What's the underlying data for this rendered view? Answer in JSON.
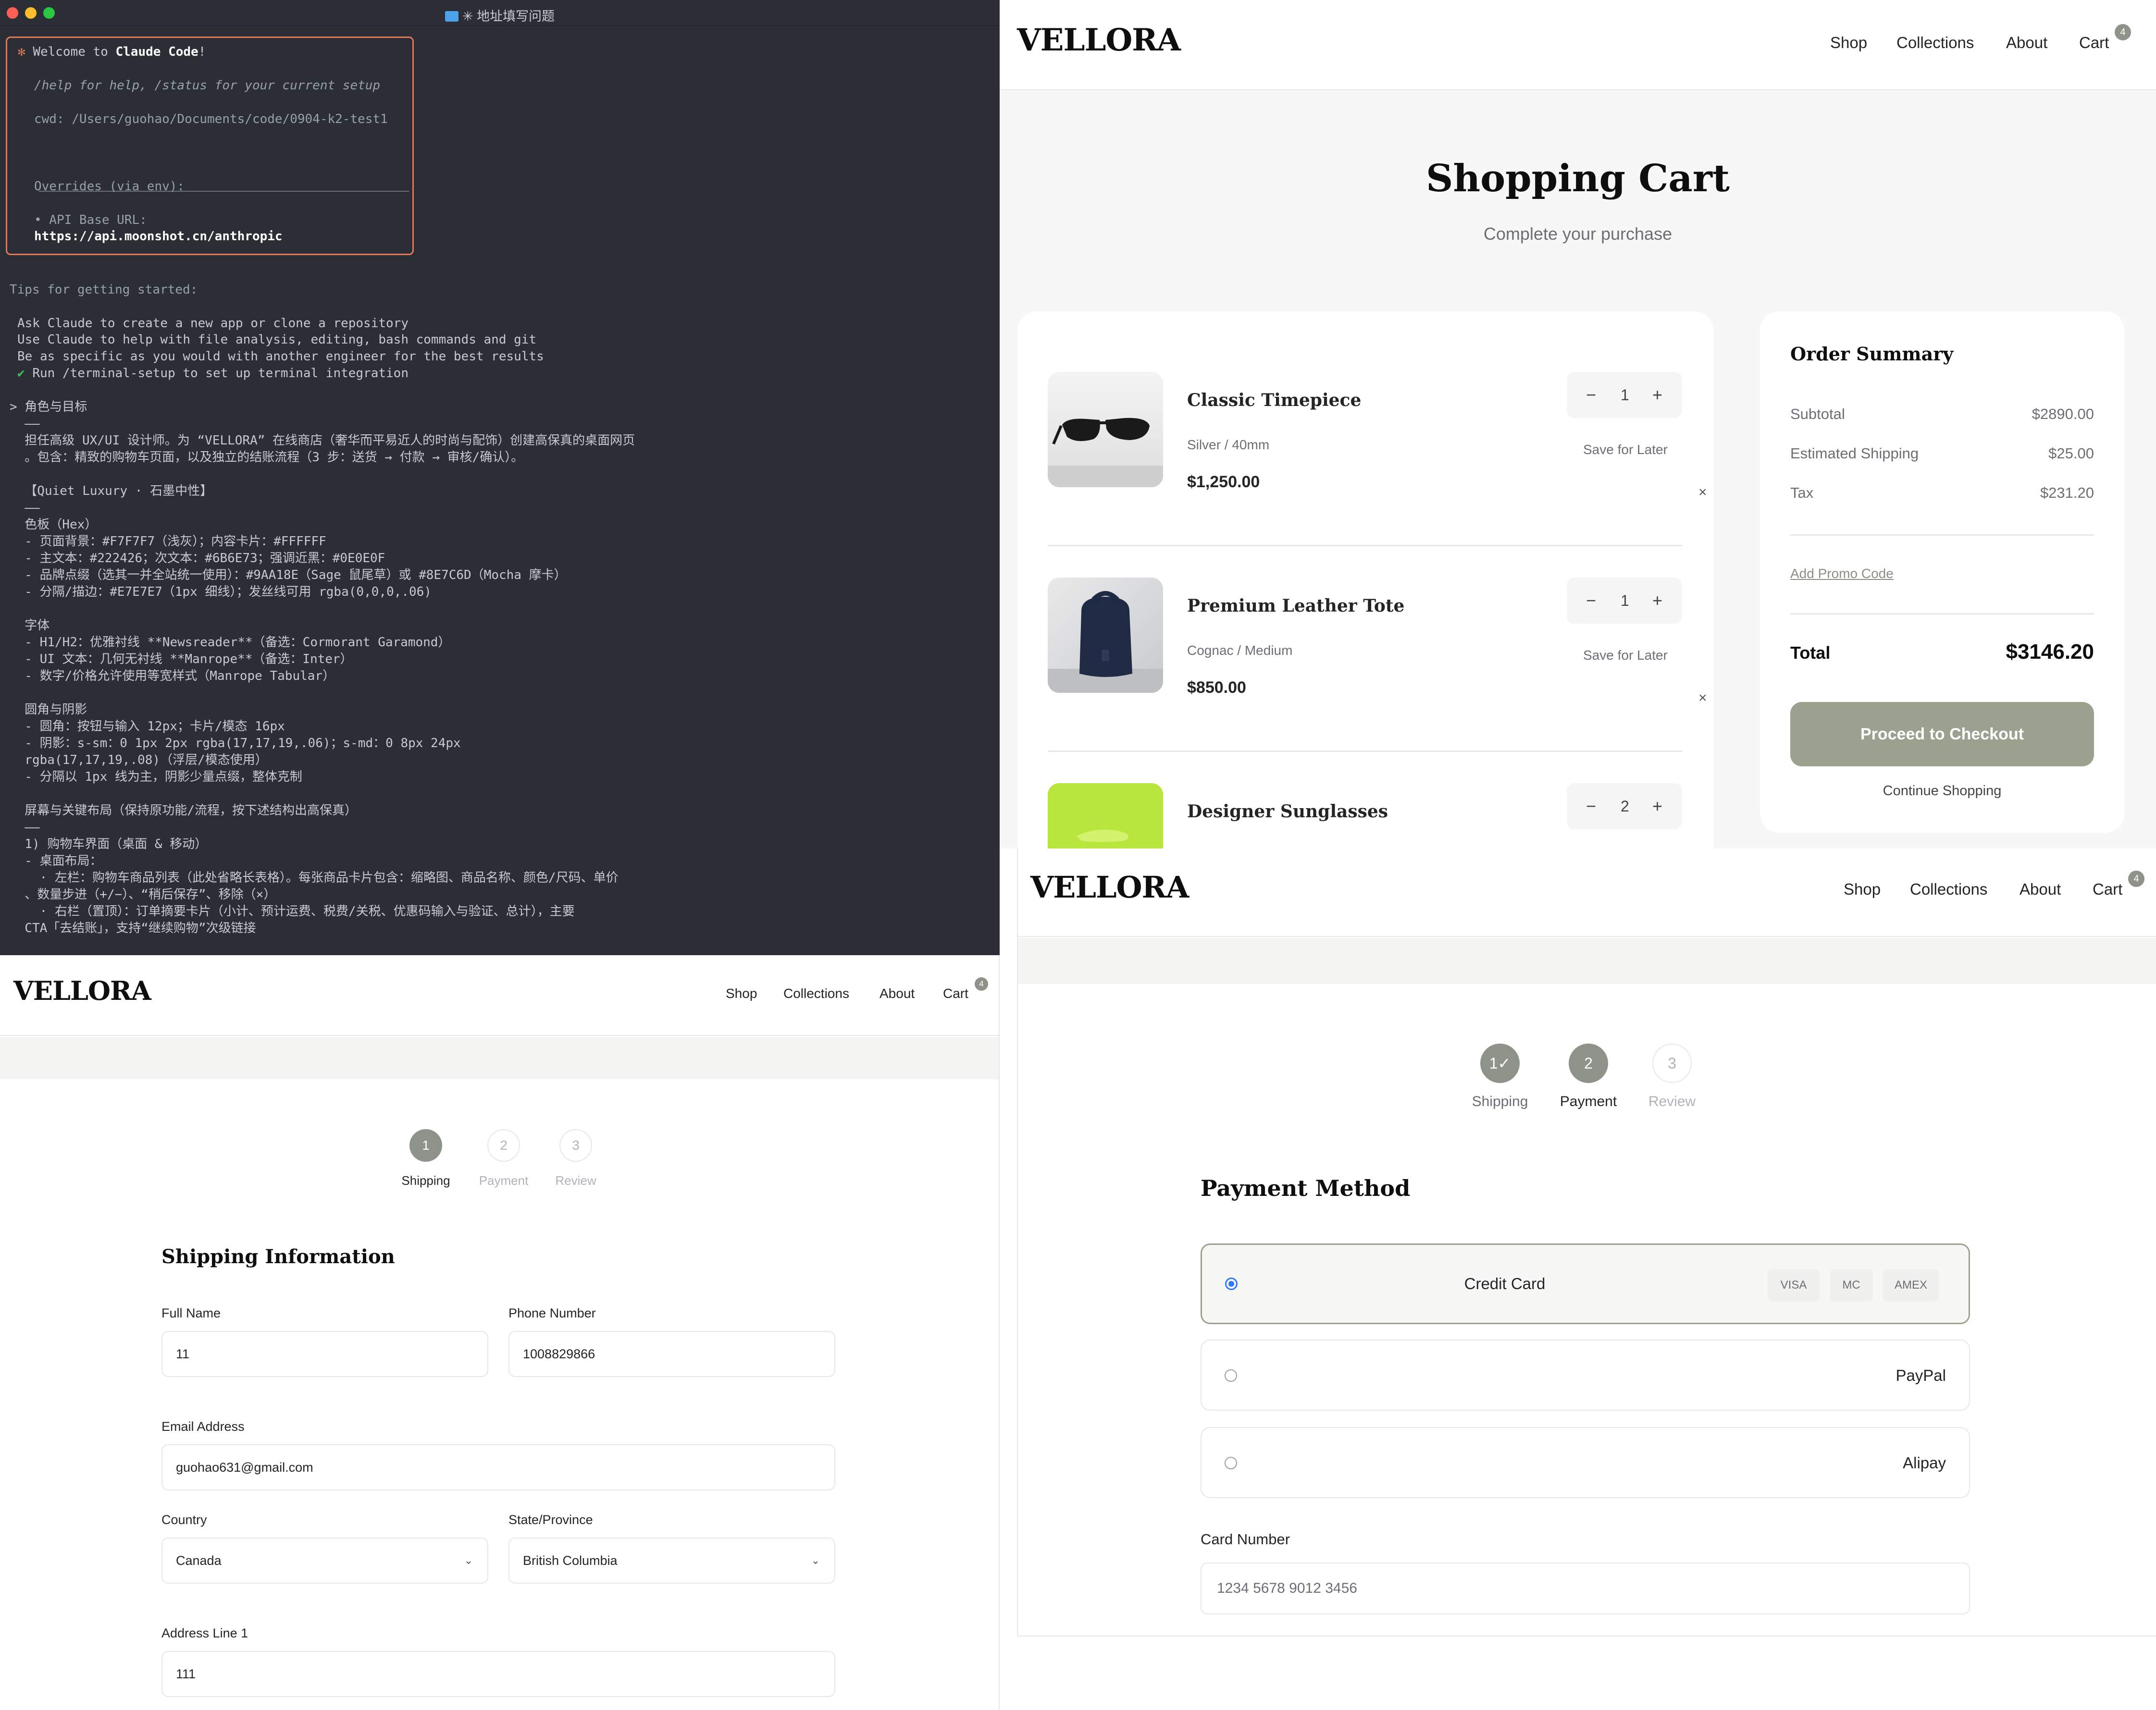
{
  "terminal": {
    "window_title": "✳ 地址填写问题",
    "welcome": {
      "star": "✻",
      "prefix": "Welcome to ",
      "app_name": "Claude Code",
      "suffix": "!",
      "help": "/help for help, /status for your current setup",
      "cwd": "cwd: /Users/guohao/Documents/code/0904-k2-test1",
      "overrides": "Overrides (via env):",
      "api_label": "• API Base URL:",
      "api_url": "https://api.moonshot.cn/anthropic"
    },
    "tips_title": "Tips for getting started:",
    "tips": [
      "Ask Claude to create a new app or clone a repository",
      "Use Claude to help with file analysis, editing, bash commands and git",
      "Be as specific as you would with another engineer for the best results"
    ],
    "tip_done_mark": "✔",
    "tip_done": "Run /terminal-setup to set up terminal integration",
    "prompt_lines": [
      "> 角色与目标",
      "  ——",
      "  担任高级 UX/UI 设计师。为 “VELLORA” 在线商店（奢华而平易近人的时尚与配饰）创建高保真的桌面网页",
      "  。包含：精致的购物车页面，以及独立的结账流程（3 步：送货 → 付款 → 审核/确认）。",
      "",
      "  【Quiet Luxury · 石墨中性】",
      "  ——",
      "  色板（Hex）",
      "  - 页面背景：#F7F7F7（浅灰）；内容卡片：#FFFFFF",
      "  - 主文本：#222426；次文本：#6B6E73；强调近黑：#0E0E0F",
      "  - 品牌点缀（选其一并全站统一使用）：#9AA18E（Sage 鼠尾草）或 #8E7C6D（Mocha 摩卡）",
      "  - 分隔/描边：#E7E7E7（1px 细线）；发丝线可用 rgba(0,0,0,.06)",
      "",
      "  字体",
      "  - H1/H2：优雅衬线 **Newsreader**（备选：Cormorant Garamond）",
      "  - UI 文本：几何无衬线 **Manrope**（备选：Inter）",
      "  - 数字/价格允许使用等宽样式（Manrope Tabular）",
      "",
      "  圆角与阴影",
      "  - 圆角：按钮与输入 12px；卡片/模态 16px",
      "  - 阴影：s-sm：0 1px 2px rgba(17,17,19,.06)；s-md：0 8px 24px",
      "  rgba(17,17,19,.08)（浮层/模态使用）",
      "  - 分隔以 1px 线为主，阴影少量点缀，整体克制",
      "",
      "  屏幕与关键布局（保持原功能/流程，按下述结构出高保真）",
      "  ——",
      "  1) 购物车界面（桌面 & 移动）",
      "  - 桌面布局：",
      "    · 左栏：购物车商品列表（此处省略长表格）。每张商品卡片包含：缩略图、商品名称、颜色/尺码、单价",
      "  、数量步进（+/−）、“稍后保存”、移除（×）",
      "    · 右栏（置顶）：订单摘要卡片（小计、预计运费、税费/关税、优惠码输入与验证、总计），主要",
      "  CTA「去结账」，支持“继续购物”次级链接"
    ]
  },
  "store": {
    "brand": "VELLORA",
    "nav": [
      "Shop",
      "Collections",
      "About",
      "Cart"
    ],
    "cart_count": "4"
  },
  "cart_page": {
    "title": "Shopping Cart",
    "subtitle": "Complete your purchase",
    "items": [
      {
        "name": "Classic Timepiece",
        "variant": "Silver / 40mm",
        "price": "$1,250.00",
        "qty": "1",
        "save_label": "Save for Later",
        "remove": "×"
      },
      {
        "name": "Premium Leather Tote",
        "variant": "Cognac / Medium",
        "price": "$850.00",
        "qty": "1",
        "save_label": "Save for Later",
        "remove": "×"
      },
      {
        "name": "Designer Sunglasses",
        "qty": "2"
      }
    ],
    "minus": "−",
    "plus": "+",
    "summary": {
      "title": "Order Summary",
      "subtotal_label": "Subtotal",
      "subtotal": "$2890.00",
      "shipping_label": "Estimated Shipping",
      "shipping": "$25.00",
      "tax_label": "Tax",
      "tax": "$231.20",
      "promo": "Add Promo Code",
      "total_label": "Total",
      "total": "$3146.20",
      "checkout": "Proceed to Checkout",
      "continue": "Continue Shopping"
    }
  },
  "shipping_page": {
    "steps": [
      {
        "num": "1",
        "label": "Shipping"
      },
      {
        "num": "2",
        "label": "Payment"
      },
      {
        "num": "3",
        "label": "Review"
      }
    ],
    "section_title": "Shipping Information",
    "fields": {
      "full_name_label": "Full Name",
      "full_name": "11",
      "phone_label": "Phone Number",
      "phone": "1008829866",
      "email_label": "Email Address",
      "email": "guohao631@gmail.com",
      "country_label": "Country",
      "country": "Canada",
      "state_label": "State/Province",
      "state": "British Columbia",
      "address1_label": "Address Line 1",
      "address1": "111"
    },
    "chevron": "⌄"
  },
  "payment_page": {
    "steps": [
      {
        "num": "1✓",
        "label": "Shipping"
      },
      {
        "num": "2",
        "label": "Payment"
      },
      {
        "num": "3",
        "label": "Review"
      }
    ],
    "section_title": "Payment Method",
    "options": [
      "Credit Card",
      "PayPal",
      "Alipay"
    ],
    "card_brands": [
      "VISA",
      "MC",
      "AMEX"
    ],
    "card_number_label": "Card Number",
    "card_number_placeholder": "1234 5678 9012 3456"
  },
  "colors": {
    "page_bg": "#F7F7F7",
    "card_bg": "#FFFFFF",
    "text_primary": "#222426",
    "text_secondary": "#6B6E73",
    "accent": "#9AA18E",
    "border": "#E7E7E7",
    "terminal_bg": "#2B2E35",
    "terminal_box": "#E0795C"
  }
}
